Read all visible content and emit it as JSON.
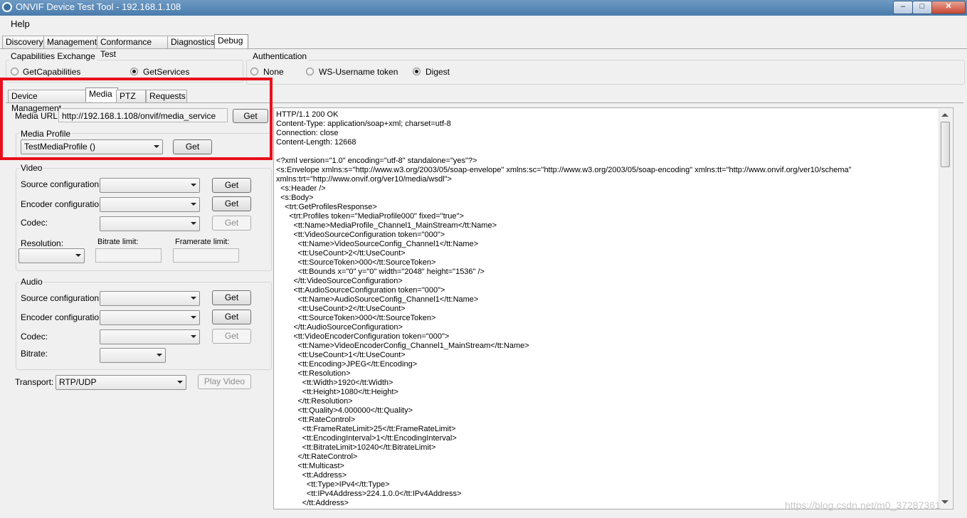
{
  "window": {
    "title": "ONVIF Device Test Tool - 192.168.1.108",
    "min": "–",
    "max": "□",
    "close": "✕"
  },
  "menu": {
    "help": "Help"
  },
  "main_tabs": [
    "Discovery",
    "Management",
    "Conformance Test",
    "Diagnostics",
    "Debug"
  ],
  "capabilities": {
    "legend": "Capabilities Exchange",
    "options": [
      "GetCapabilities",
      "GetServices"
    ],
    "selected": "GetServices"
  },
  "authentication": {
    "legend": "Authentication",
    "options": [
      "None",
      "WS-Username token",
      "Digest"
    ],
    "selected": "Digest"
  },
  "sub_tabs": [
    "Device Management",
    "Media",
    "PTZ",
    "Requests"
  ],
  "media": {
    "url_label": "Media URL:",
    "url_value": "http://192.168.1.108/onvif/media_service",
    "get": "Get",
    "profile_legend": "Media Profile",
    "profile_value": "TestMediaProfile ()"
  },
  "video": {
    "legend": "Video",
    "source_label": "Source configuration:",
    "encoder_label": "Encoder configuration:",
    "codec_label": "Codec:",
    "resolution_label": "Resolution:",
    "bitrate_label": "Bitrate limit:",
    "framerate_label": "Framerate limit:",
    "get": "Get"
  },
  "audio": {
    "legend": "Audio",
    "source_label": "Source configuration:",
    "encoder_label": "Encoder configuration:",
    "codec_label": "Codec:",
    "bitrate_label": "Bitrate:",
    "get": "Get"
  },
  "transport": {
    "label": "Transport:",
    "value": "RTP/UDP",
    "play": "Play Video"
  },
  "response_lines": [
    "HTTP/1.1 200 OK",
    "Content-Type: application/soap+xml; charset=utf-8",
    "Connection: close",
    "Content-Length: 12668",
    "",
    "<?xml version=\"1.0\" encoding=\"utf-8\" standalone=\"yes\"?>",
    "<s:Envelope xmlns:s=\"http://www.w3.org/2003/05/soap-envelope\" xmlns:sc=\"http://www.w3.org/2003/05/soap-encoding\" xmlns:tt=\"http://www.onvif.org/ver10/schema\"",
    "xmlns:trt=\"http://www.onvif.org/ver10/media/wsdl\">",
    "  <s:Header />",
    "  <s:Body>",
    "    <trt:GetProfilesResponse>",
    "      <trt:Profiles token=\"MediaProfile000\" fixed=\"true\">",
    "        <tt:Name>MediaProfile_Channel1_MainStream</tt:Name>",
    "        <tt:VideoSourceConfiguration token=\"000\">",
    "          <tt:Name>VideoSourceConfig_Channel1</tt:Name>",
    "          <tt:UseCount>2</tt:UseCount>",
    "          <tt:SourceToken>000</tt:SourceToken>",
    "          <tt:Bounds x=\"0\" y=\"0\" width=\"2048\" height=\"1536\" />",
    "        </tt:VideoSourceConfiguration>",
    "        <tt:AudioSourceConfiguration token=\"000\">",
    "          <tt:Name>AudioSourceConfig_Channel1</tt:Name>",
    "          <tt:UseCount>2</tt:UseCount>",
    "          <tt:SourceToken>000</tt:SourceToken>",
    "        </tt:AudioSourceConfiguration>",
    "        <tt:VideoEncoderConfiguration token=\"000\">",
    "          <tt:Name>VideoEncoderConfig_Channel1_MainStream</tt:Name>",
    "          <tt:UseCount>1</tt:UseCount>",
    "          <tt:Encoding>JPEG</tt:Encoding>",
    "          <tt:Resolution>",
    "            <tt:Width>1920</tt:Width>",
    "            <tt:Height>1080</tt:Height>",
    "          </tt:Resolution>",
    "          <tt:Quality>4.000000</tt:Quality>",
    "          <tt:RateControl>",
    "            <tt:FrameRateLimit>25</tt:FrameRateLimit>",
    "            <tt:EncodingInterval>1</tt:EncodingInterval>",
    "            <tt:BitrateLimit>10240</tt:BitrateLimit>",
    "          </tt:RateControl>",
    "          <tt:Multicast>",
    "            <tt:Address>",
    "              <tt:Type>IPv4</tt:Type>",
    "              <tt:IPv4Address>224.1.0.0</tt:IPv4Address>",
    "            </tt:Address>"
  ],
  "watermark": "https://blog.csdn.net/m0_37287361"
}
